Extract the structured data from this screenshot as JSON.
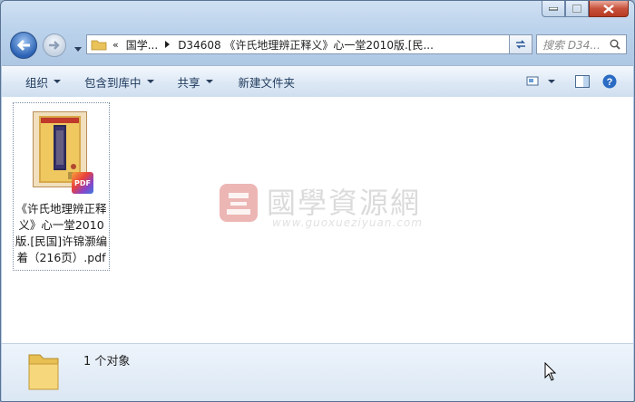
{
  "window": {
    "caption_buttons": [
      "minimize",
      "maximize",
      "close"
    ]
  },
  "nav": {
    "breadcrumb_overflow": "«",
    "crumbs": [
      "国学...",
      "D34608 《许氏地理辨正释义》心一堂2010版.[民..."
    ],
    "search_placeholder": "搜索 D34...",
    "icons": [
      "back-arrow-icon",
      "forward-arrow-icon",
      "folder-icon",
      "refresh-icon",
      "search-icon"
    ]
  },
  "toolbar": {
    "organize": "组织",
    "include_library": "包含到库中",
    "share": "共享",
    "new_folder": "新建文件夹",
    "icons": [
      "view-icon",
      "preview-pane-icon",
      "help-icon"
    ]
  },
  "files": [
    {
      "name": "《许氏地理辨正释义》心一堂2010版.[民国]许锦灏编着（216页）.pdf",
      "badge": "PDF",
      "cover_text": "許氏地理辨正釋義"
    }
  ],
  "watermark": {
    "title": "國學資源網",
    "url": "www.guoxueziyuan.com"
  },
  "status": {
    "count": "1 个对象"
  },
  "colors": {
    "close_button": "#c7523b",
    "accent": "#2b62b4",
    "watermark": "#c9302c"
  }
}
